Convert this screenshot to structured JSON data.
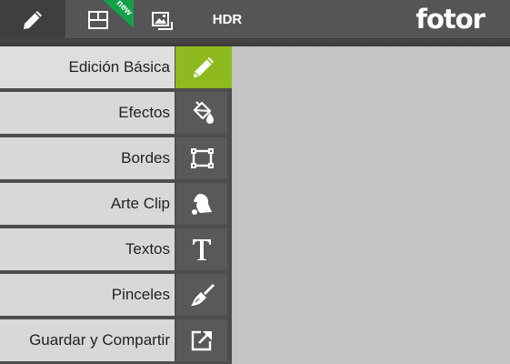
{
  "toolbar": {
    "hdr_label": "HDR",
    "new_badge": "new",
    "logo": "fotor"
  },
  "menu": {
    "items": [
      {
        "label": "Edición Básica",
        "icon": "pencil-icon",
        "active": true
      },
      {
        "label": "Efectos",
        "icon": "paint-bucket-icon",
        "active": false
      },
      {
        "label": "Bordes",
        "icon": "frame-icon",
        "active": false
      },
      {
        "label": "Arte Clip",
        "icon": "bell-clipart-icon",
        "active": false
      },
      {
        "label": "Textos",
        "icon": "text-t-icon",
        "active": false
      },
      {
        "label": "Pinceles",
        "icon": "brush-icon",
        "active": false
      },
      {
        "label": "Guardar y Compartir",
        "icon": "share-export-icon",
        "active": false
      }
    ]
  },
  "colors": {
    "accent": "#8fba1f",
    "badge": "#13a04a",
    "topbar": "#555555",
    "canvas": "#c4c4c4"
  }
}
